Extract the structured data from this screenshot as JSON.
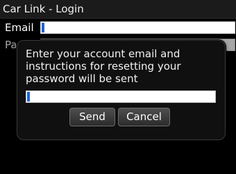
{
  "window": {
    "title": "Car Link - Login"
  },
  "form": {
    "email_label": "Email",
    "email_value": "",
    "password_label": "Pa",
    "password_value": ""
  },
  "dialog": {
    "message": "Enter your account email and instructions for resetting your password will be sent",
    "reset_email_value": "",
    "send_label": "Send",
    "cancel_label": "Cancel"
  },
  "colors": {
    "background": "#000000",
    "caret": "#1e63d6",
    "dialog_bg": "#101010",
    "button_border": "#6c6c6c"
  }
}
